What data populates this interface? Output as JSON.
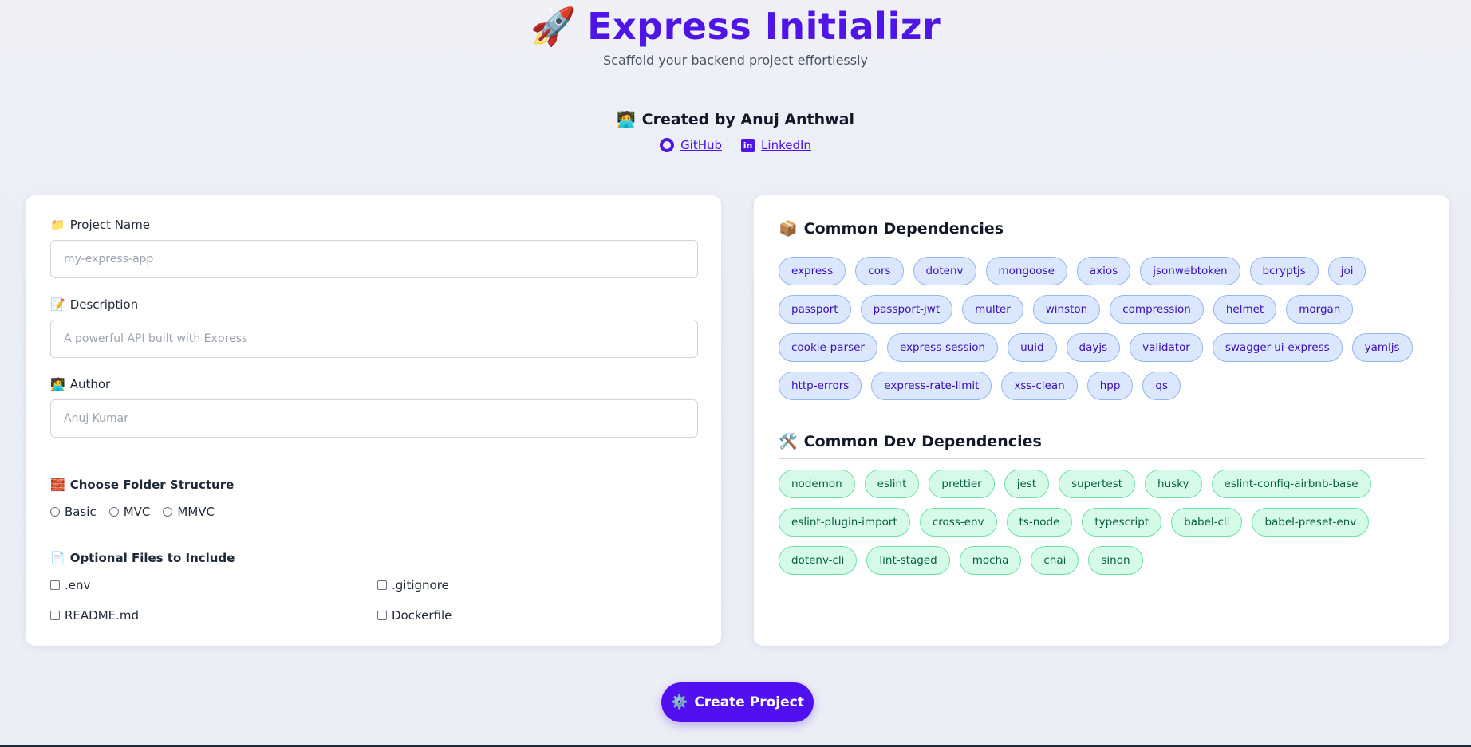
{
  "header": {
    "rocket_icon": "🚀",
    "title": "Express Initializr",
    "subtitle": "Scaffold your backend project effortlessly"
  },
  "creator": {
    "icon": "🧑‍💻",
    "text": "Created by Anuj Anthwal",
    "github_label": "GitHub",
    "linkedin_label": "LinkedIn"
  },
  "form": {
    "project_name": {
      "icon": "📁",
      "label": "Project Name",
      "placeholder": "my-express-app",
      "value": ""
    },
    "description": {
      "icon": "📝",
      "label": "Description",
      "placeholder": "A powerful API built with Express",
      "value": ""
    },
    "author": {
      "icon": "🧑‍💻",
      "label": "Author",
      "placeholder": "Anuj Kumar",
      "value": ""
    },
    "folder": {
      "icon": "🧱",
      "label": "Choose Folder Structure",
      "options": [
        "Basic",
        "MVC",
        "MMVC"
      ]
    },
    "optional": {
      "icon": "📄",
      "label": "Optional Files to Include",
      "files": [
        ".env",
        ".gitignore",
        "README.md",
        "Dockerfile"
      ]
    }
  },
  "dependencies": {
    "icon": "📦",
    "title": "Common Dependencies",
    "items": [
      "express",
      "cors",
      "dotenv",
      "mongoose",
      "axios",
      "jsonwebtoken",
      "bcryptjs",
      "joi",
      "passport",
      "passport-jwt",
      "multer",
      "winston",
      "compression",
      "helmet",
      "morgan",
      "cookie-parser",
      "express-session",
      "uuid",
      "dayjs",
      "validator",
      "swagger-ui-express",
      "yamljs",
      "http-errors",
      "express-rate-limit",
      "xss-clean",
      "hpp",
      "qs"
    ]
  },
  "dev_dependencies": {
    "icon": "🛠️",
    "title": "Common Dev Dependencies",
    "items": [
      "nodemon",
      "eslint",
      "prettier",
      "jest",
      "supertest",
      "husky",
      "eslint-config-airbnb-base",
      "eslint-plugin-import",
      "cross-env",
      "ts-node",
      "typescript",
      "babel-cli",
      "babel-preset-env",
      "dotenv-cli",
      "lint-staged",
      "mocha",
      "chai",
      "sinon"
    ]
  },
  "create_button": {
    "icon": "⚙️",
    "label": "Create Project"
  },
  "colors": {
    "accent": "#4f14e6",
    "button": "#5010f0",
    "dep_bg": "#dbe7fd",
    "dev_bg": "#d5fbe8"
  }
}
